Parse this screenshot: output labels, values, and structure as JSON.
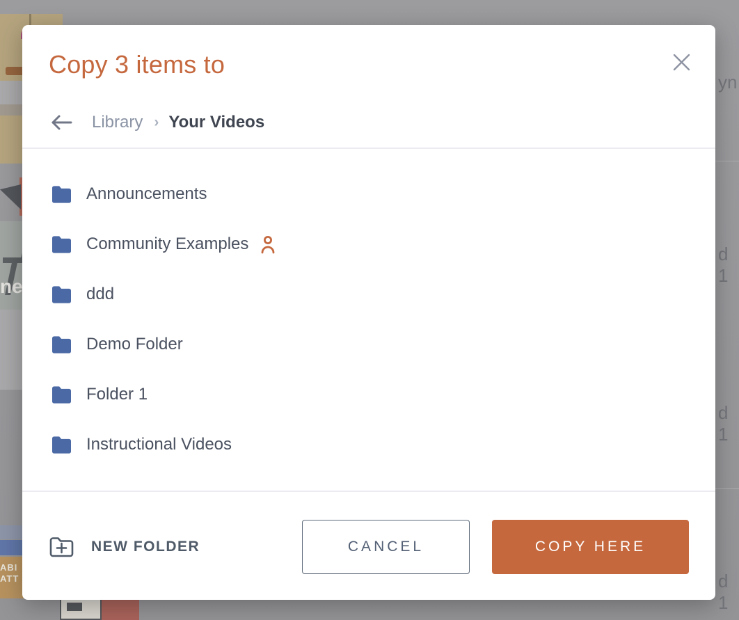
{
  "colors": {
    "accent_orange": "#c5683e",
    "folder_blue": "#4b69a5",
    "text_dark": "#3f4550",
    "text_muted": "#8a93a4",
    "slate": "#4f5a68"
  },
  "background": {
    "fragments": {
      "top_right": "yn",
      "right_1": "d 1",
      "right_2": "d 1",
      "right_3": "d 1",
      "left_partial": "ne",
      "thumb_text_line1": "ABI",
      "thumb_text_line2": "ATT"
    }
  },
  "modal": {
    "title": "Copy 3 items to",
    "close_icon": "x-close",
    "breadcrumb": {
      "back_icon": "arrow-left",
      "parent": "Library",
      "separator": "›",
      "current": "Your Videos"
    },
    "folders": [
      {
        "name": "Announcements",
        "shared": false
      },
      {
        "name": "Community Examples",
        "shared": true
      },
      {
        "name": "ddd",
        "shared": false
      },
      {
        "name": "Demo Folder",
        "shared": false
      },
      {
        "name": "Folder 1",
        "shared": false
      },
      {
        "name": "Instructional Videos",
        "shared": false
      }
    ],
    "footer": {
      "new_folder_label": "NEW FOLDER",
      "cancel_label": "CANCEL",
      "copy_label": "COPY HERE"
    }
  }
}
